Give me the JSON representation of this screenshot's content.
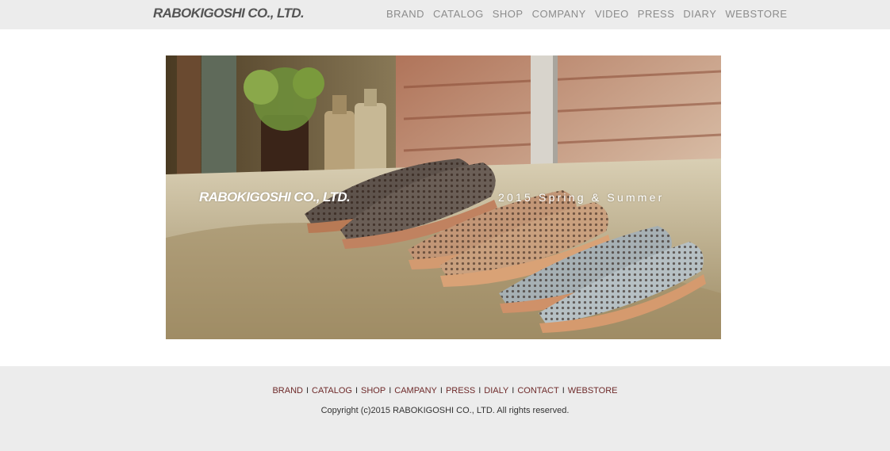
{
  "header": {
    "logo": "RABOKIGOSHI CO., LTD.",
    "nav": [
      "BRAND",
      "CATALOG",
      "SHOP",
      "COMPANY",
      "VIDEO",
      "PRESS",
      "DIARY",
      "WEBSTORE"
    ]
  },
  "hero": {
    "logo": "RABOKIGOSHI CO., LTD.",
    "caption": "2015 Spring & Summer"
  },
  "footer": {
    "links": [
      "BRAND",
      "CATALOG",
      "SHOP",
      "CAMPANY",
      "PRESS",
      "DIALY",
      "CONTACT",
      "WEBSTORE"
    ],
    "separator": "I",
    "copyright": "Copyright (c)2015 RABOKIGOSHI CO., LTD. All rights reserved."
  }
}
